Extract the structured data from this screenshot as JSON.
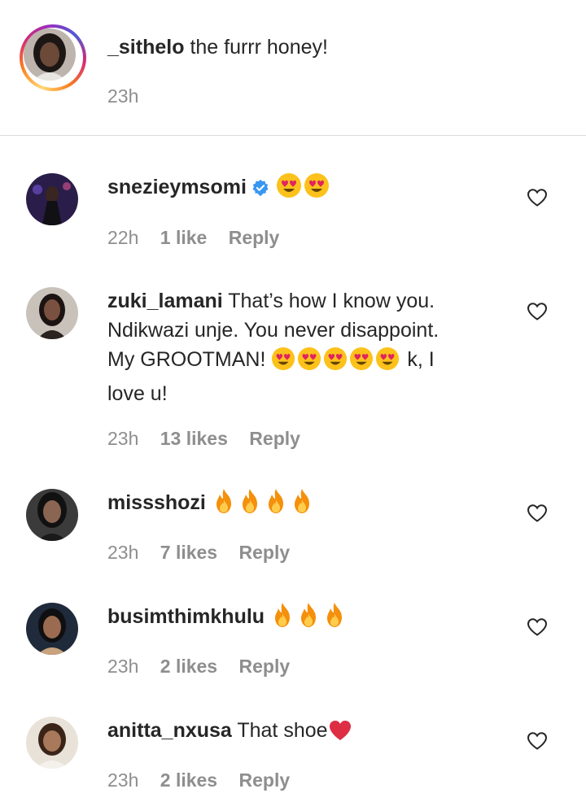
{
  "caption": {
    "username": "_sithelo",
    "text": "the furrr honey!",
    "time": "23h"
  },
  "comments": [
    {
      "username": "snezieymsomi",
      "verified": true,
      "text": "",
      "emojis": [
        "heart-eyes",
        "heart-eyes"
      ],
      "time": "22h",
      "likes": "1 like",
      "reply": "Reply"
    },
    {
      "username": "zuki_lamani",
      "text_line1": "That’s how I know you.",
      "text_line2": "Ndikwazi unje. You never disappoint.",
      "text_line3_pre": "My GROOTMAN!",
      "text_line3_post": "k, I",
      "text_line4": "love u!",
      "emojis": [
        "heart-eyes",
        "heart-eyes",
        "heart-eyes",
        "heart-eyes",
        "heart-eyes"
      ],
      "time": "23h",
      "likes": "13 likes",
      "reply": "Reply"
    },
    {
      "username": "missshozi",
      "text": "",
      "emojis": [
        "fire",
        "fire",
        "fire",
        "fire"
      ],
      "time": "23h",
      "likes": "7 likes",
      "reply": "Reply"
    },
    {
      "username": "busimthimkhulu",
      "text": "",
      "emojis": [
        "fire",
        "fire",
        "fire"
      ],
      "time": "23h",
      "likes": "2 likes",
      "reply": "Reply"
    },
    {
      "username": "anitta_nxusa",
      "text": "That shoe",
      "emojis": [
        "red-heart"
      ],
      "time": "23h",
      "likes": "2 likes",
      "reply": "Reply"
    }
  ],
  "colors": {
    "text": "#262626",
    "meta": "#8e8e8e",
    "verified": "#3897f0",
    "divider": "#dbdbdb"
  }
}
